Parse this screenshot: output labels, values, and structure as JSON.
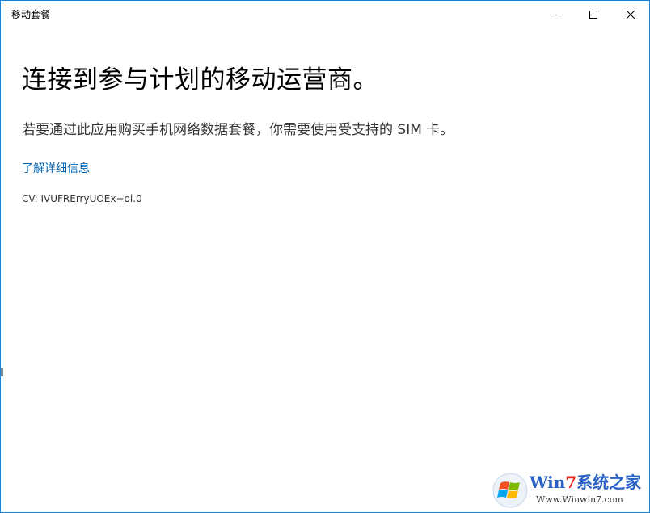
{
  "window": {
    "title": "移动套餐",
    "border_color": "#1883d7"
  },
  "titlebar": {
    "minimize_icon": "minimize-icon",
    "maximize_icon": "maximize-icon",
    "close_icon": "close-icon"
  },
  "main": {
    "heading": "连接到参与计划的移动运营商。",
    "description": "若要通过此应用购买手机网络数据套餐，你需要使用受支持的 SIM 卡。",
    "learn_more_link": "了解详细信息",
    "link_color": "#0063b1",
    "cv": "CV: IVUFRErryUOEx+oi.0"
  },
  "watermark": {
    "brand_prefix": "Win",
    "brand_accent": "7",
    "brand_suffix": "系统之家",
    "url": "Www.Winwin7.com"
  }
}
